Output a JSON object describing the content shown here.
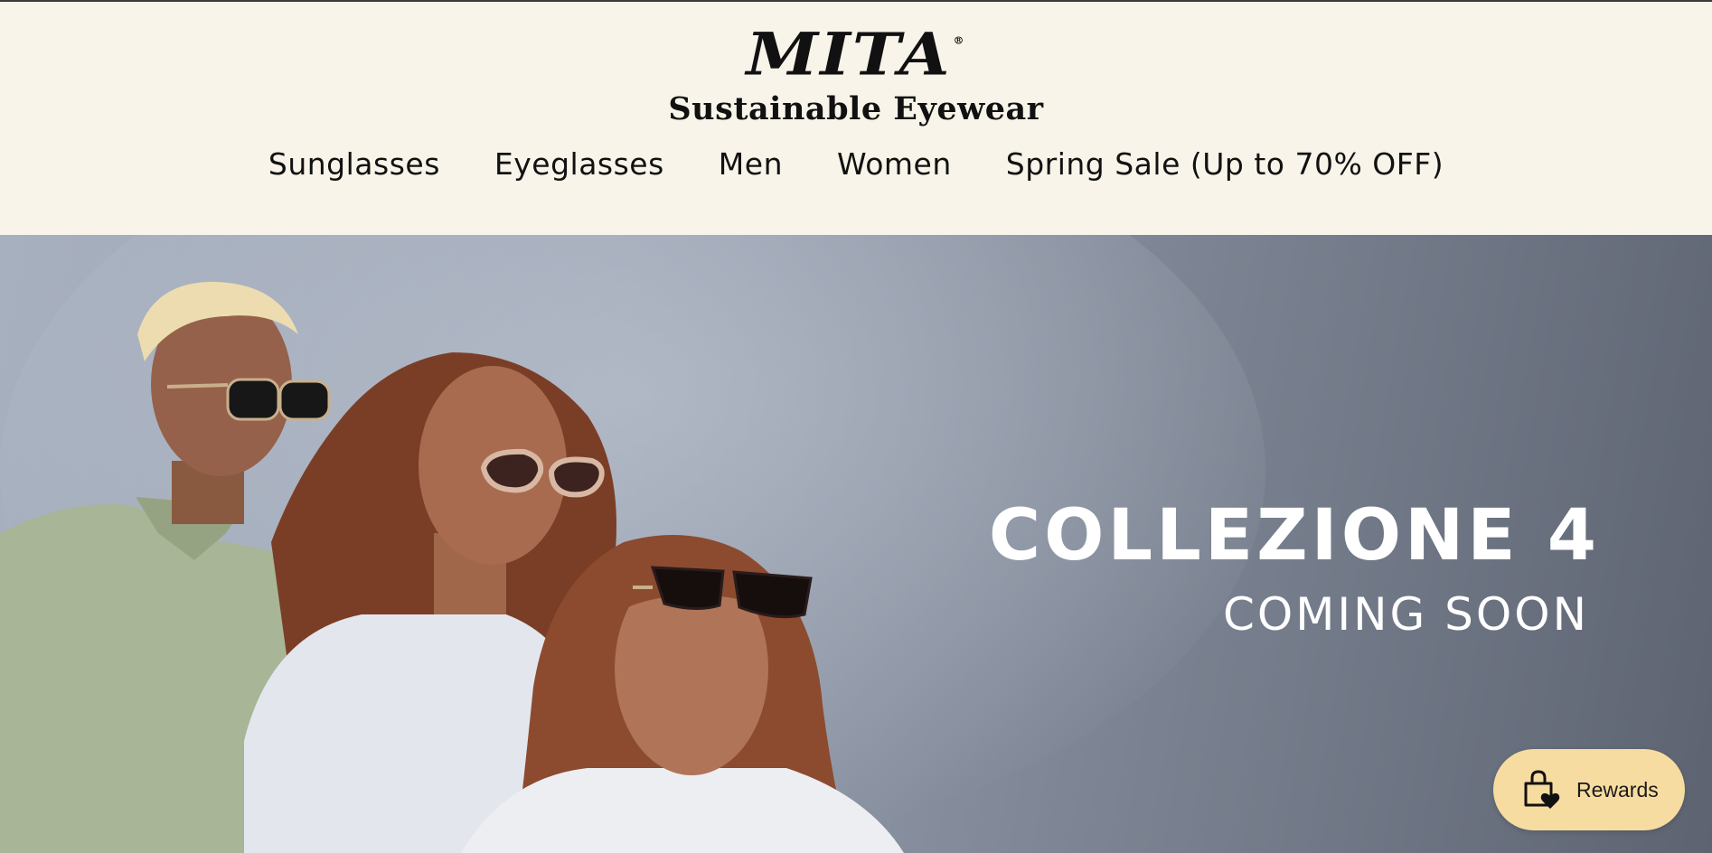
{
  "header": {
    "logo": "MITA",
    "logo_registered": "®",
    "tagline": "Sustainable Eyewear",
    "nav": [
      {
        "label": "Sunglasses"
      },
      {
        "label": "Eyeglasses"
      },
      {
        "label": "Men"
      },
      {
        "label": "Women"
      },
      {
        "label": "Spring Sale (Up to 70% OFF)"
      }
    ]
  },
  "hero": {
    "title": "COLLEZIONE 4",
    "subtitle": "COMING SOON",
    "image_subject": "three models wearing sunglasses"
  },
  "rewards": {
    "label": "Rewards",
    "icon": "shopping-bag-heart-icon"
  },
  "colors": {
    "header_background": "#f8f4ea",
    "hero_text": "#ffffff",
    "rewards_background": "#f6dca0"
  }
}
